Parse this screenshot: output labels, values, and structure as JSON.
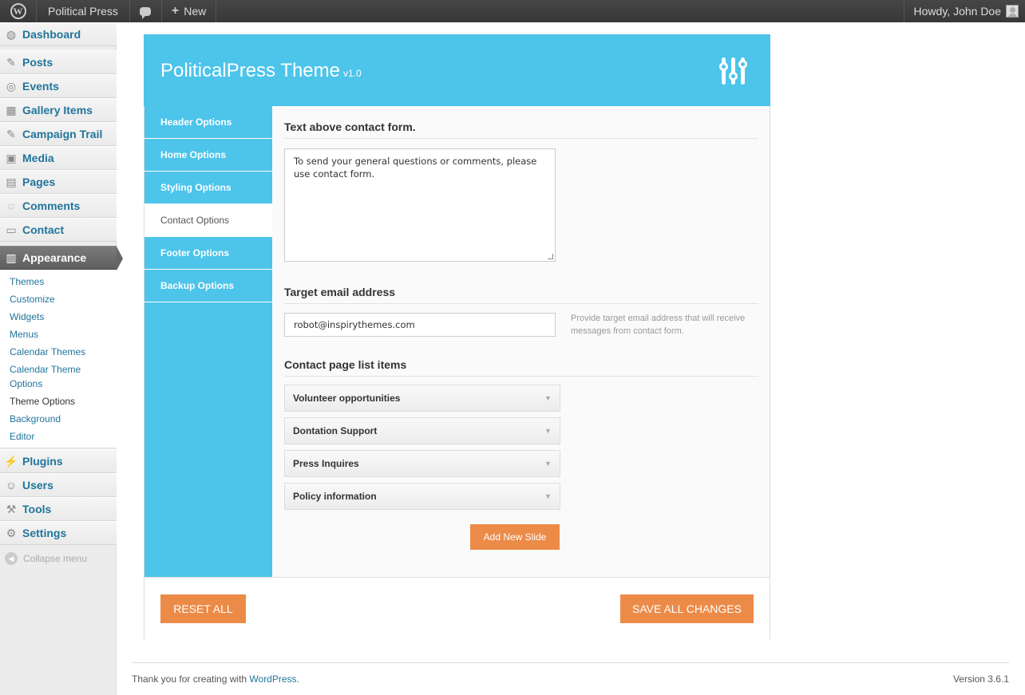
{
  "adminbar": {
    "site_name": "Political Press",
    "new_label": "New",
    "howdy": "Howdy, John Doe"
  },
  "menu": {
    "items": [
      {
        "label": "Dashboard",
        "icon": "dashboard-icon"
      },
      {
        "label": "Posts",
        "icon": "pushpin-icon"
      },
      {
        "label": "Events",
        "icon": "events-icon"
      },
      {
        "label": "Gallery Items",
        "icon": "grid-icon"
      },
      {
        "label": "Campaign Trail",
        "icon": "pushpin-icon"
      },
      {
        "label": "Media",
        "icon": "media-icon"
      },
      {
        "label": "Pages",
        "icon": "pages-icon"
      },
      {
        "label": "Comments",
        "icon": "comment-icon"
      },
      {
        "label": "Contact",
        "icon": "contact-icon"
      },
      {
        "label": "Appearance",
        "icon": "appearance-icon"
      },
      {
        "label": "Plugins",
        "icon": "plug-icon"
      },
      {
        "label": "Users",
        "icon": "users-icon"
      },
      {
        "label": "Tools",
        "icon": "tools-icon"
      },
      {
        "label": "Settings",
        "icon": "settings-icon"
      }
    ],
    "submenu": [
      "Themes",
      "Customize",
      "Widgets",
      "Menus",
      "Calendar Themes",
      "Calendar Theme Options",
      "Theme Options",
      "Background",
      "Editor"
    ],
    "collapse_label": "Collapse menu"
  },
  "panel": {
    "title": "PoliticalPress Theme",
    "version": "v1.0",
    "tabs": [
      "Header Options",
      "Home Options",
      "Styling Options",
      "Contact Options",
      "Footer Options",
      "Backup Options"
    ],
    "active_tab": "Contact Options",
    "contact": {
      "text_above_title": "Text above contact form.",
      "text_above_value": "To send your general questions or comments, please use contact form.",
      "email_title": "Target email address",
      "email_value": "robot@inspirythemes.com",
      "email_hint": "Provide target email address that will receive messages from contact form.",
      "list_title": "Contact page list items",
      "list_items": [
        "Volunteer opportunities",
        "Dontation Support",
        "Press Inquires",
        "Policy information"
      ],
      "add_button": "Add New Slide"
    },
    "reset_button": "RESET ALL",
    "save_button": "SAVE ALL CHANGES"
  },
  "footer": {
    "thanks_prefix": "Thank you for creating with ",
    "wordpress_link": "WordPress",
    "thanks_suffix": ".",
    "version": "Version 3.6.1"
  },
  "colors": {
    "accent": "#4dc4ea",
    "button": "#ec8b48",
    "link": "#21759b"
  }
}
